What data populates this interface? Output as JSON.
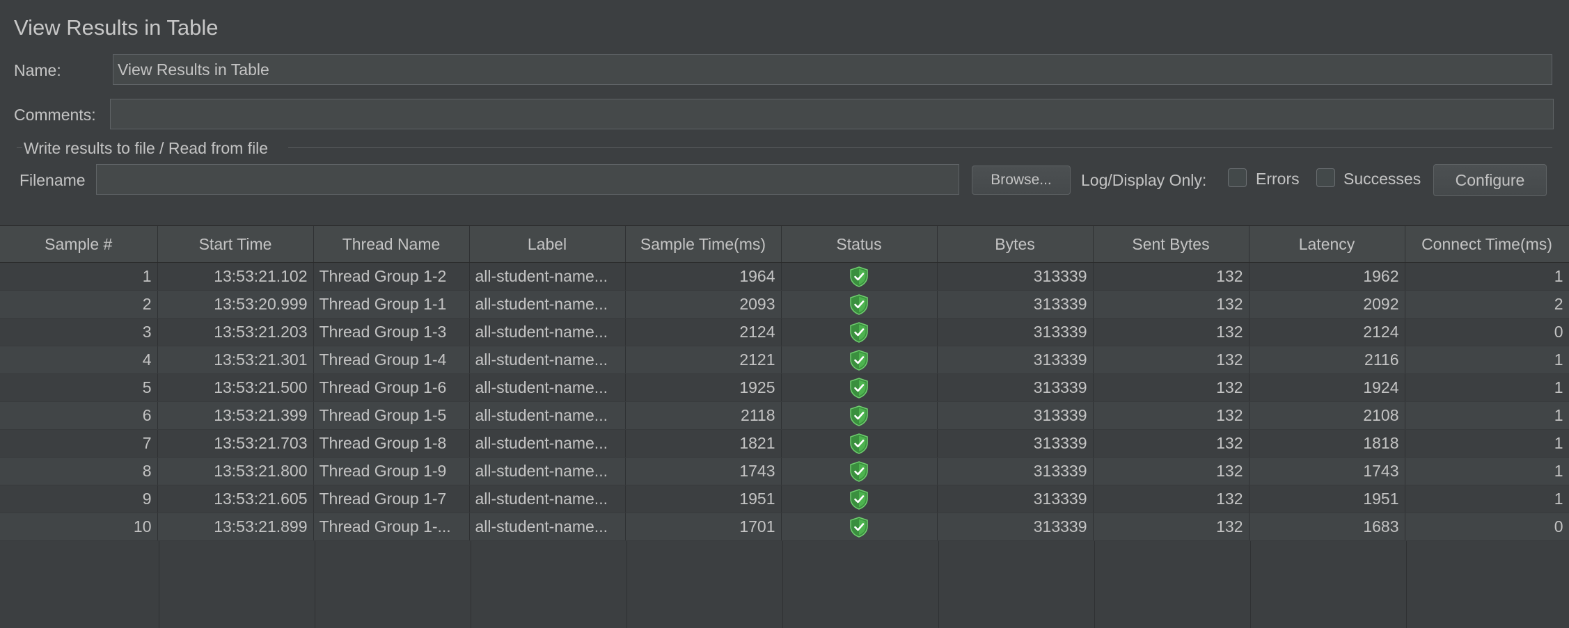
{
  "title": "View Results in Table",
  "name_label": "Name:",
  "name_value": "View Results in Table",
  "comments_label": "Comments:",
  "comments_value": "",
  "group_title": "Write results to file / Read from file",
  "filename_label": "Filename",
  "filename_value": "",
  "browse_label": "Browse...",
  "log_display_label": "Log/Display Only:",
  "errors_label": "Errors",
  "successes_label": "Successes",
  "configure_label": "Configure",
  "columns": [
    "Sample #",
    "Start Time",
    "Thread Name",
    "Label",
    "Sample Time(ms)",
    "Status",
    "Bytes",
    "Sent Bytes",
    "Latency",
    "Connect Time(ms)"
  ],
  "rows": [
    {
      "sample": "1",
      "start": "13:53:21.102",
      "thread": "Thread Group 1-2",
      "label": "all-student-name...",
      "sample_time": "1964",
      "status": "success-shield-icon",
      "bytes": "313339",
      "sent": "132",
      "latency": "1962",
      "connect": "1"
    },
    {
      "sample": "2",
      "start": "13:53:20.999",
      "thread": "Thread Group 1-1",
      "label": "all-student-name...",
      "sample_time": "2093",
      "status": "success-shield-icon",
      "bytes": "313339",
      "sent": "132",
      "latency": "2092",
      "connect": "2"
    },
    {
      "sample": "3",
      "start": "13:53:21.203",
      "thread": "Thread Group 1-3",
      "label": "all-student-name...",
      "sample_time": "2124",
      "status": "success-shield-icon",
      "bytes": "313339",
      "sent": "132",
      "latency": "2124",
      "connect": "0"
    },
    {
      "sample": "4",
      "start": "13:53:21.301",
      "thread": "Thread Group 1-4",
      "label": "all-student-name...",
      "sample_time": "2121",
      "status": "success-shield-icon",
      "bytes": "313339",
      "sent": "132",
      "latency": "2116",
      "connect": "1"
    },
    {
      "sample": "5",
      "start": "13:53:21.500",
      "thread": "Thread Group 1-6",
      "label": "all-student-name...",
      "sample_time": "1925",
      "status": "success-shield-icon",
      "bytes": "313339",
      "sent": "132",
      "latency": "1924",
      "connect": "1"
    },
    {
      "sample": "6",
      "start": "13:53:21.399",
      "thread": "Thread Group 1-5",
      "label": "all-student-name...",
      "sample_time": "2118",
      "status": "success-shield-icon",
      "bytes": "313339",
      "sent": "132",
      "latency": "2108",
      "connect": "1"
    },
    {
      "sample": "7",
      "start": "13:53:21.703",
      "thread": "Thread Group 1-8",
      "label": "all-student-name...",
      "sample_time": "1821",
      "status": "success-shield-icon",
      "bytes": "313339",
      "sent": "132",
      "latency": "1818",
      "connect": "1"
    },
    {
      "sample": "8",
      "start": "13:53:21.800",
      "thread": "Thread Group 1-9",
      "label": "all-student-name...",
      "sample_time": "1743",
      "status": "success-shield-icon",
      "bytes": "313339",
      "sent": "132",
      "latency": "1743",
      "connect": "1"
    },
    {
      "sample": "9",
      "start": "13:53:21.605",
      "thread": "Thread Group 1-7",
      "label": "all-student-name...",
      "sample_time": "1951",
      "status": "success-shield-icon",
      "bytes": "313339",
      "sent": "132",
      "latency": "1951",
      "connect": "1"
    },
    {
      "sample": "10",
      "start": "13:53:21.899",
      "thread": "Thread Group 1-...",
      "label": "all-student-name...",
      "sample_time": "1701",
      "status": "success-shield-icon",
      "bytes": "313339",
      "sent": "132",
      "latency": "1683",
      "connect": "0"
    }
  ],
  "colors": {
    "background": "#3c3f41",
    "success": "#4caf50"
  }
}
